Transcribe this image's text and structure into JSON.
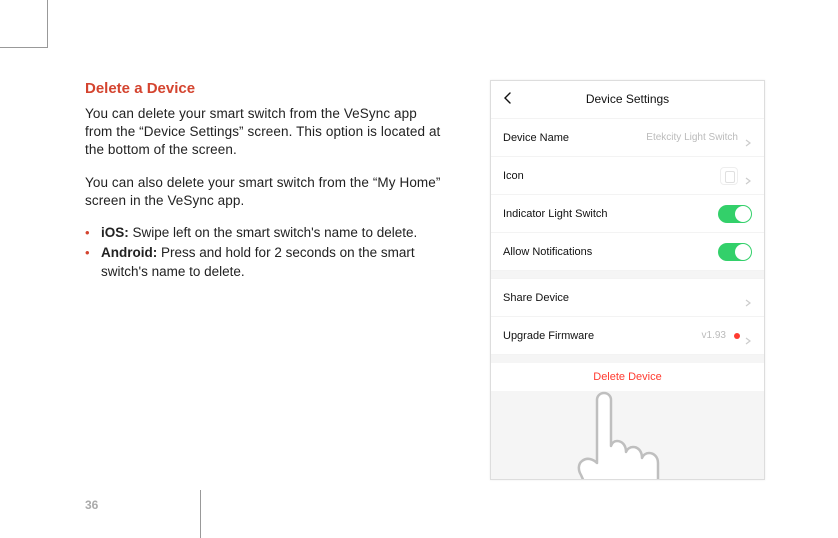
{
  "page_number": "36",
  "heading": "Delete a Device",
  "para1": "You can delete your smart switch from the VeSync app from the “Device Settings” screen. This option is located at the bottom of the screen.",
  "para2": "You can also delete your smart switch from the “My Home” screen in the VeSync app.",
  "bullet_ios_label": "iOS:",
  "bullet_ios_text": " Swipe left on the smart switch's name to delete.",
  "bullet_android_label": "Android:",
  "bullet_android_text": " Press and hold for 2 seconds on the smart switch's name to delete.",
  "phone": {
    "title": "Device Settings",
    "rows": {
      "device_name": {
        "label": "Device Name",
        "value": "Etekcity Light Switch"
      },
      "icon": {
        "label": "Icon"
      },
      "indicator": {
        "label": "Indicator Light Switch"
      },
      "notif": {
        "label": "Allow Notifications"
      },
      "share": {
        "label": "Share Device"
      },
      "upgrade": {
        "label": "Upgrade Firmware",
        "value": "v1.93"
      }
    },
    "delete_label": "Delete Device"
  }
}
